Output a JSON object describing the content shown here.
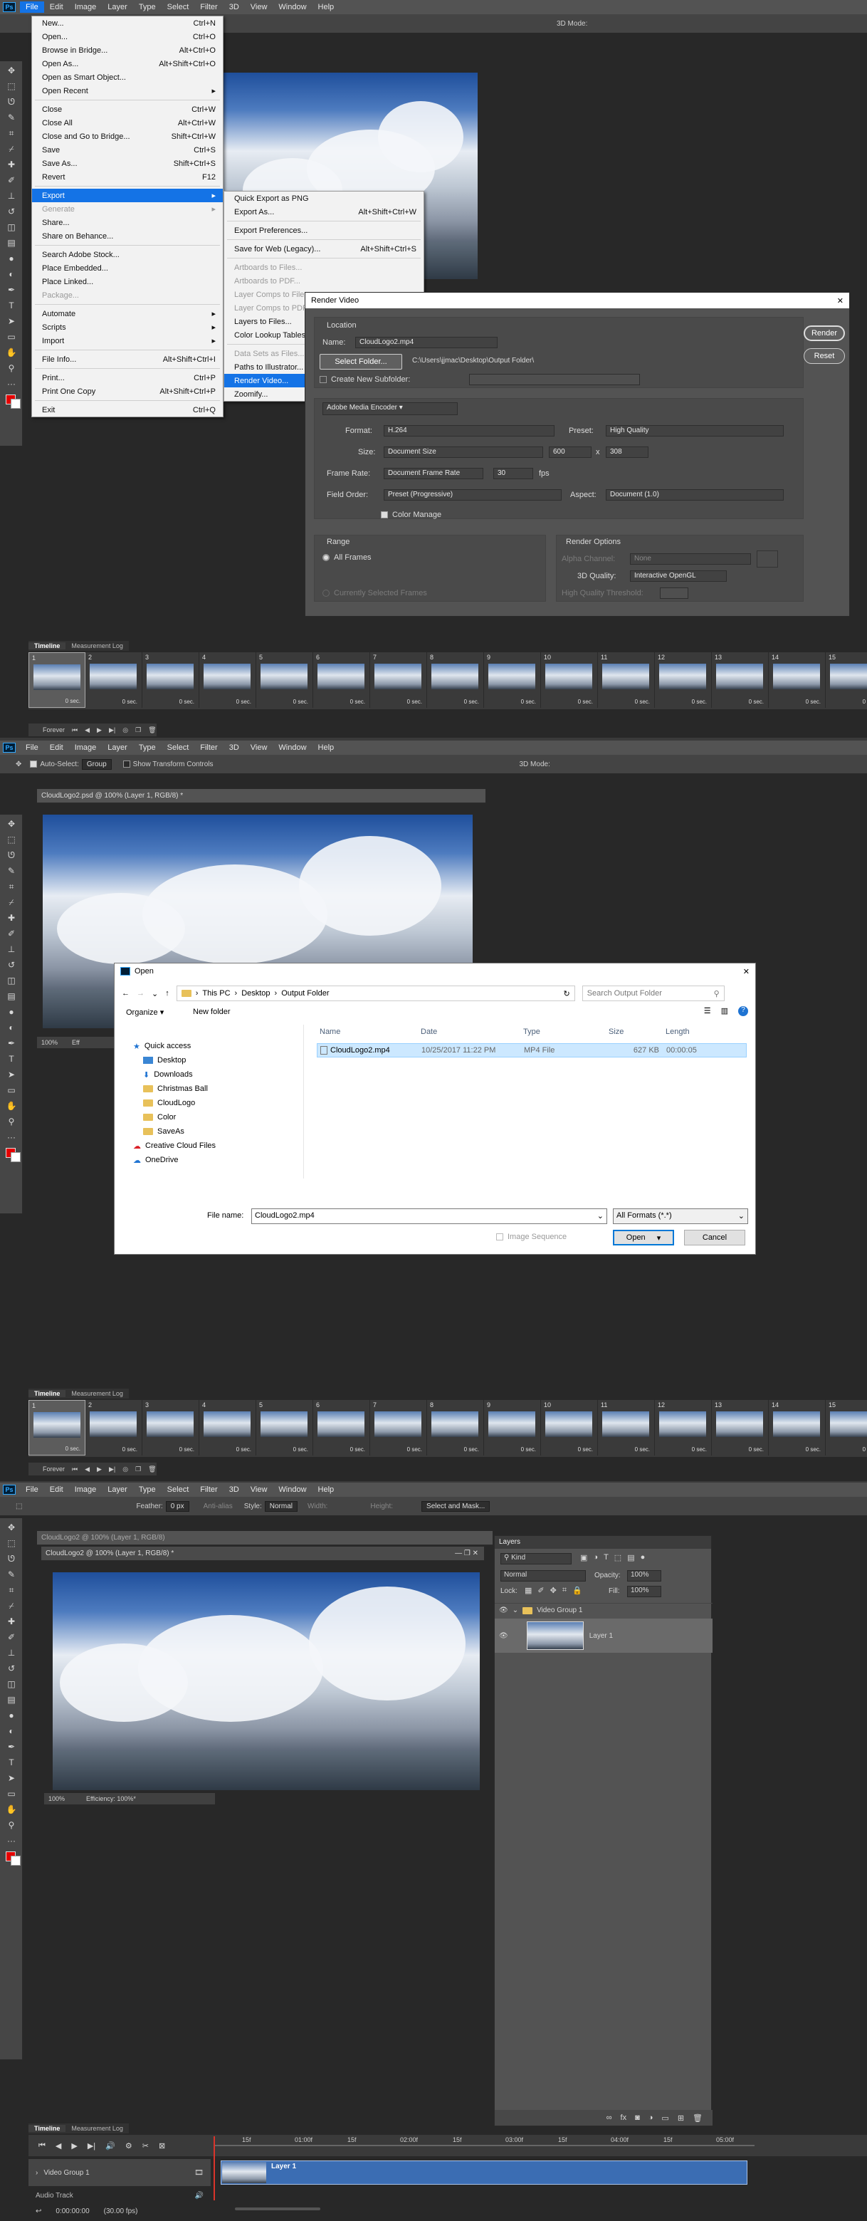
{
  "menubar": [
    "File",
    "Edit",
    "Image",
    "Layer",
    "Type",
    "Select",
    "Filter",
    "3D",
    "View",
    "Window",
    "Help"
  ],
  "options1": {
    "mode3d": "3D Mode:"
  },
  "file_menu": [
    {
      "label": "New...",
      "shortcut": "Ctrl+N"
    },
    {
      "label": "Open...",
      "shortcut": "Ctrl+O"
    },
    {
      "label": "Browse in Bridge...",
      "shortcut": "Alt+Ctrl+O"
    },
    {
      "label": "Open As...",
      "shortcut": "Alt+Shift+Ctrl+O"
    },
    {
      "label": "Open as Smart Object...",
      "shortcut": ""
    },
    {
      "label": "Open Recent",
      "shortcut": "▸"
    },
    {
      "sep": true
    },
    {
      "label": "Close",
      "shortcut": "Ctrl+W"
    },
    {
      "label": "Close All",
      "shortcut": "Alt+Ctrl+W"
    },
    {
      "label": "Close and Go to Bridge...",
      "shortcut": "Shift+Ctrl+W"
    },
    {
      "label": "Save",
      "shortcut": "Ctrl+S"
    },
    {
      "label": "Save As...",
      "shortcut": "Shift+Ctrl+S"
    },
    {
      "label": "Revert",
      "shortcut": "F12"
    },
    {
      "sep": true
    },
    {
      "label": "Export",
      "shortcut": "▸",
      "hl": true
    },
    {
      "label": "Generate",
      "shortcut": "▸",
      "dis": true
    },
    {
      "label": "Share...",
      "shortcut": ""
    },
    {
      "label": "Share on Behance...",
      "shortcut": ""
    },
    {
      "sep": true
    },
    {
      "label": "Search Adobe Stock...",
      "shortcut": ""
    },
    {
      "label": "Place Embedded...",
      "shortcut": ""
    },
    {
      "label": "Place Linked...",
      "shortcut": ""
    },
    {
      "label": "Package...",
      "shortcut": "",
      "dis": true
    },
    {
      "sep": true
    },
    {
      "label": "Automate",
      "shortcut": "▸"
    },
    {
      "label": "Scripts",
      "shortcut": "▸"
    },
    {
      "label": "Import",
      "shortcut": "▸"
    },
    {
      "sep": true
    },
    {
      "label": "File Info...",
      "shortcut": "Alt+Shift+Ctrl+I"
    },
    {
      "sep": true
    },
    {
      "label": "Print...",
      "shortcut": "Ctrl+P"
    },
    {
      "label": "Print One Copy",
      "shortcut": "Alt+Shift+Ctrl+P"
    },
    {
      "sep": true
    },
    {
      "label": "Exit",
      "shortcut": "Ctrl+Q"
    }
  ],
  "export_menu": [
    {
      "label": "Quick Export as PNG",
      "shortcut": ""
    },
    {
      "label": "Export As...",
      "shortcut": "Alt+Shift+Ctrl+W"
    },
    {
      "sep": true
    },
    {
      "label": "Export Preferences...",
      "shortcut": ""
    },
    {
      "sep": true
    },
    {
      "label": "Save for Web (Legacy)...",
      "shortcut": "Alt+Shift+Ctrl+S"
    },
    {
      "sep": true
    },
    {
      "label": "Artboards to Files...",
      "shortcut": "",
      "dis": true
    },
    {
      "label": "Artboards to PDF...",
      "shortcut": "",
      "dis": true
    },
    {
      "label": "Layer Comps to Files...",
      "shortcut": "",
      "dis": true
    },
    {
      "label": "Layer Comps to PDF...",
      "shortcut": "",
      "dis": true
    },
    {
      "label": "Layers to Files...",
      "shortcut": ""
    },
    {
      "label": "Color Lookup Tables...",
      "shortcut": ""
    },
    {
      "sep": true
    },
    {
      "label": "Data Sets as Files...",
      "shortcut": "",
      "dis": true
    },
    {
      "label": "Paths to Illustrator...",
      "shortcut": ""
    },
    {
      "label": "Render Video...",
      "shortcut": "",
      "hl": true
    },
    {
      "label": "Zoomify...",
      "shortcut": ""
    }
  ],
  "render": {
    "title": "Render Video",
    "location": "Location",
    "name_label": "Name:",
    "name": "CloudLogo2.mp4",
    "select_folder": "Select Folder...",
    "path": "C:\\Users\\jjmac\\Desktop\\Output Folder\\",
    "subfolder": "Create New Subfolder:",
    "encoder": "Adobe Media Encoder",
    "format_label": "Format:",
    "format": "H.264",
    "preset_label": "Preset:",
    "preset": "High Quality",
    "size_label": "Size:",
    "size": "Document Size",
    "w": "600",
    "x": "x",
    "h": "308",
    "fr_label": "Frame Rate:",
    "fr": "Document Frame Rate",
    "fps": "30",
    "fps_unit": "fps",
    "fo_label": "Field Order:",
    "fo": "Preset (Progressive)",
    "aspect_label": "Aspect:",
    "aspect": "Document (1.0)",
    "color_manage": "Color Manage",
    "range": "Range",
    "all_frames": "All Frames",
    "current_sel": "Currently Selected Frames",
    "render_opts": "Render Options",
    "alpha_label": "Alpha Channel:",
    "alpha": "None",
    "q3d_label": "3D Quality:",
    "q3d": "Interactive OpenGL",
    "hqt_label": "High Quality Threshold:",
    "render_btn": "Render",
    "reset_btn": "Reset"
  },
  "timeline": {
    "tab": "Timeline",
    "tab2": "Measurement Log",
    "frames": [
      "1",
      "2",
      "3",
      "4",
      "5",
      "6",
      "7",
      "8",
      "9",
      "10",
      "11",
      "12",
      "13",
      "14",
      "15"
    ],
    "dur": "0 sec.",
    "loop": "Forever"
  },
  "options2": {
    "autoselect": "Auto-Select:",
    "group": "Group",
    "transform": "Show Transform Controls",
    "mode3d": "3D Mode:"
  },
  "doc2": {
    "tab": "CloudLogo2.psd @ 100% (Layer 1, RGB/8) *",
    "zoom": "100%",
    "eff": "Eff"
  },
  "open": {
    "title": "Open",
    "crumbs": [
      "This PC",
      "Desktop",
      "Output Folder"
    ],
    "search": "Search Output Folder",
    "organize": "Organize ▾",
    "newfolder": "New folder",
    "nav": [
      "Quick access",
      "Desktop",
      "Downloads",
      "Christmas Ball",
      "CloudLogo",
      "Color",
      "SaveAs",
      "Creative Cloud Files",
      "OneDrive"
    ],
    "cols": [
      "Name",
      "Date",
      "Type",
      "Size",
      "Length"
    ],
    "file": {
      "name": "CloudLogo2.mp4",
      "date": "10/25/2017 11:22 PM",
      "type": "MP4 File",
      "size": "627 KB",
      "length": "00:00:05"
    },
    "fname_label": "File name:",
    "fname": "CloudLogo2.mp4",
    "filter": "All Formats (*.*)",
    "imgseq": "Image Sequence",
    "open_btn": "Open",
    "cancel_btn": "Cancel"
  },
  "options3": {
    "feather": "Feather:",
    "feather_val": "0 px",
    "antialias": "Anti-alias",
    "style": "Style:",
    "style_val": "Normal",
    "width": "Width:",
    "height": "Height:",
    "select_mask": "Select and Mask..."
  },
  "doc3": {
    "tab_bg": "CloudLogo2 @ 100% (Layer 1, RGB/8)",
    "tab": "CloudLogo2 @ 100% (Layer 1, RGB/8) *",
    "zoom": "100%",
    "eff": "Efficiency: 100%*"
  },
  "layers": {
    "title": "Layers",
    "kind": "Kind",
    "blend": "Normal",
    "opacity_label": "Opacity:",
    "opacity": "100%",
    "lock": "Lock:",
    "fill_label": "Fill:",
    "fill": "100%",
    "group": "Video Group 1",
    "layer": "Layer 1"
  },
  "tl3": {
    "ticks": [
      "15f",
      "01:00f",
      "15f",
      "02:00f",
      "15f",
      "03:00f",
      "15f",
      "04:00f",
      "15f",
      "05:00f"
    ],
    "track": "Video Group 1",
    "clip": "Layer 1",
    "audio": "Audio Track",
    "time": "0:00:00:00",
    "fps": "(30.00 fps)"
  }
}
